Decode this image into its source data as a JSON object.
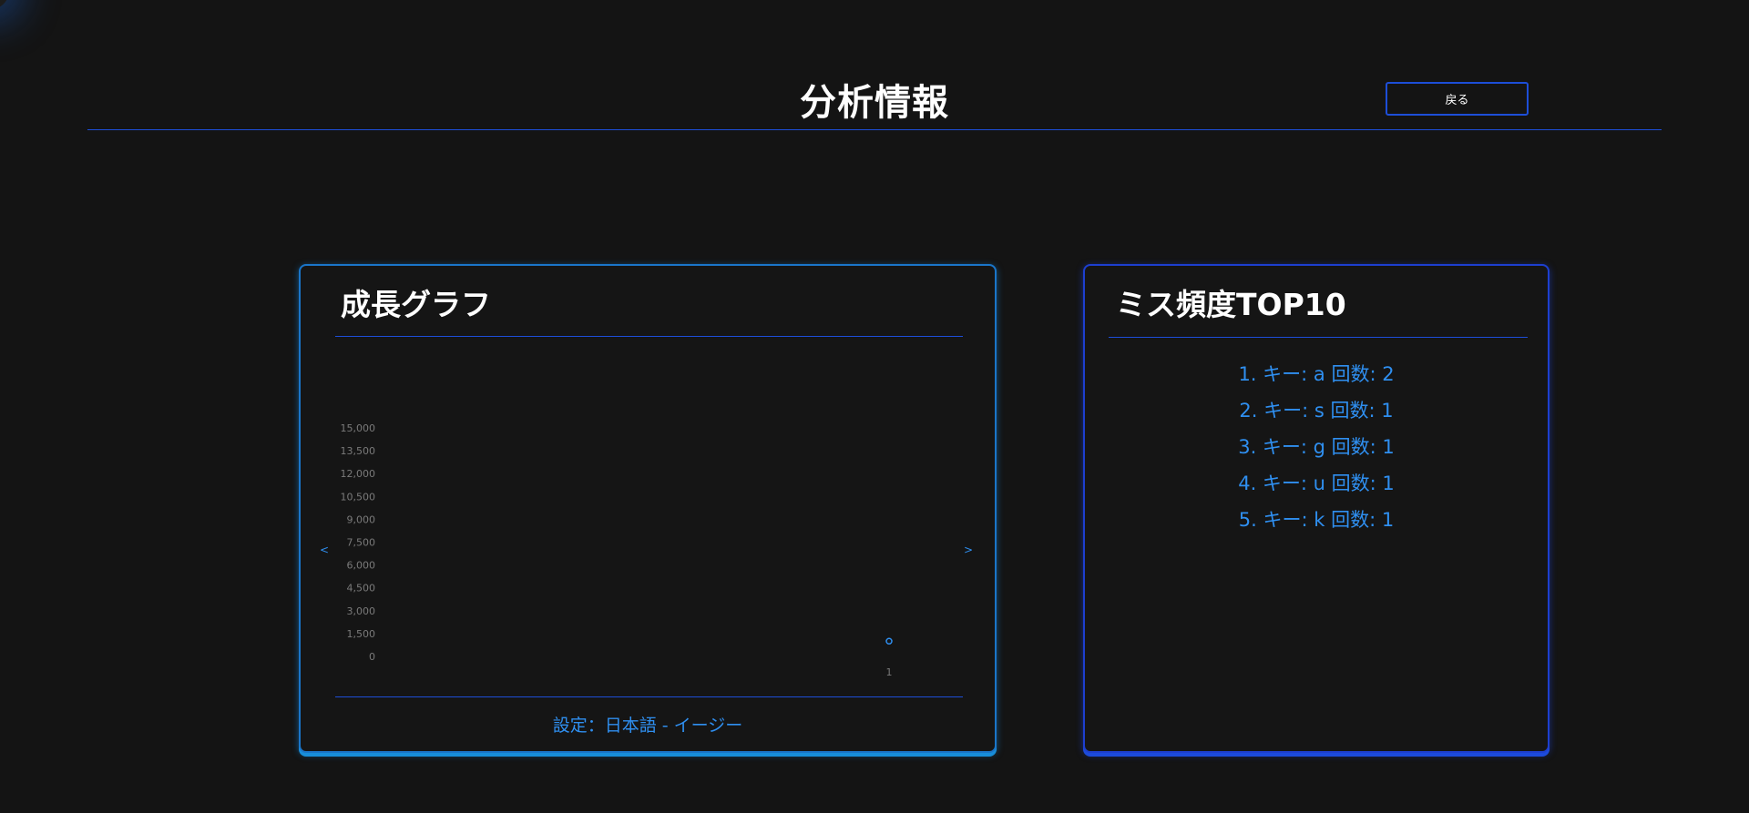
{
  "header": {
    "title": "分析情報",
    "back_label": "戻る"
  },
  "growth_card": {
    "title": "成長グラフ",
    "prev_label": "<",
    "next_label": ">",
    "setting_label": "設定：日本語 - イージー"
  },
  "miss_card": {
    "title": "ミス頻度TOP10",
    "items": [
      {
        "text": "1. キー: a 回数: 2"
      },
      {
        "text": "2. キー: s 回数: 1"
      },
      {
        "text": "3. キー: g 回数: 1"
      },
      {
        "text": "4. キー: u 回数: 1"
      },
      {
        "text": "5. キー: k 回数: 1"
      }
    ]
  },
  "colors": {
    "accent_blue": "#1d4ed8",
    "text_blue": "#2f8ff0",
    "cyan_glow": "#1a8fd6",
    "background": "#141414"
  },
  "chart_data": {
    "type": "line",
    "x": [
      "1"
    ],
    "series": [
      {
        "values": [
          1000
        ]
      }
    ],
    "yticks": [
      "15,000",
      "13,500",
      "12,000",
      "10,500",
      "9,000",
      "7,500",
      "6,000",
      "4,500",
      "3,000",
      "1,500",
      "0"
    ],
    "ylim": [
      0,
      15000
    ],
    "grid": false
  }
}
